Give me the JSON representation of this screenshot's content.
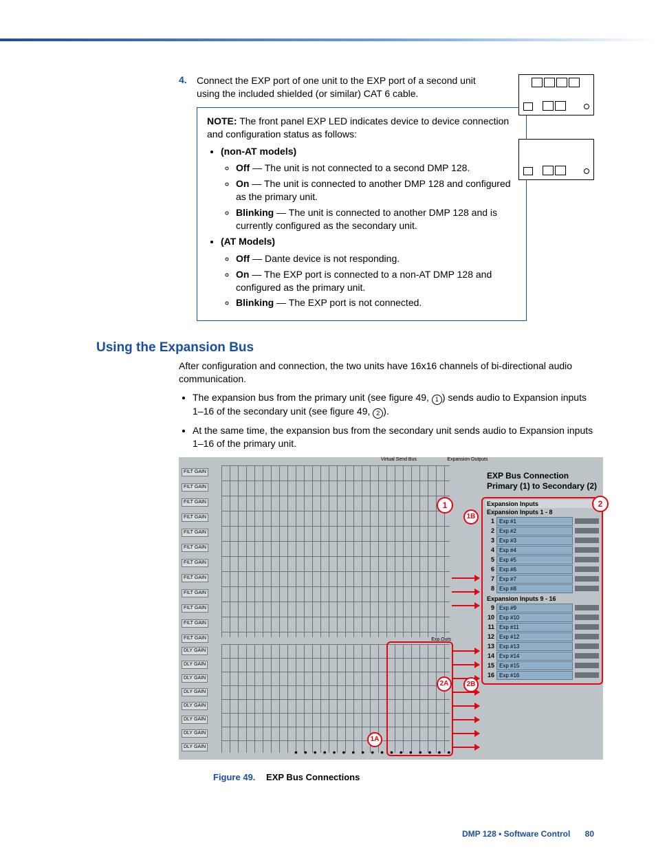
{
  "step": {
    "number": "4.",
    "text": "Connect the EXP port of one unit to the EXP port of a second unit using the included shielded (or similar) CAT 6 cable."
  },
  "note": {
    "label": "NOTE:",
    "intro": "The front panel EXP LED indicates device to device connection and configuration status as follows:",
    "groups": [
      {
        "title": "(non-AT models)",
        "items": [
          {
            "state": "Off",
            "desc": "— The unit is not connected to a second DMP 128."
          },
          {
            "state": "On",
            "desc": "— The unit is connected to another DMP 128 and configured as the primary unit."
          },
          {
            "state": "Blinking",
            "desc": "— The unit is connected to another DMP 128 and is currently configured as the secondary unit."
          }
        ]
      },
      {
        "title": "(AT Models)",
        "items": [
          {
            "state": "Off",
            "desc": "— Dante device is not responding."
          },
          {
            "state": "On",
            "desc": "— The EXP port is connected to a non-AT DMP 128 and configured as the primary unit."
          },
          {
            "state": "Blinking",
            "desc": "— The EXP port is not connected."
          }
        ]
      }
    ]
  },
  "section_title": "Using the Expansion Bus",
  "section_intro": "After configuration and connection, the two units have 16x16 channels of bi-directional audio communication.",
  "bullets": [
    {
      "pre": "The expansion bus from the primary unit (see figure 49, ",
      "ref": "1",
      "mid": ") sends audio to Expansion inputs 1–16 of the secondary unit (see figure 49, ",
      "ref2": "2",
      "post": ")."
    },
    {
      "text": "At the same time, the expansion bus from the secondary unit sends audio to Expansion inputs 1–16 of the primary unit."
    }
  ],
  "fig49": {
    "col_head_left": "Virtual Send Bus",
    "col_head_right": "Expansion Outputs",
    "exp_outs_label": "Exp.Outs",
    "right_title_l1": "EXP Bus Connection",
    "right_title_l2": "Primary (1) to Secondary (2)",
    "exp_inputs_head": "Expansion Inputs",
    "exp_inputs_sub1": "Expansion Inputs 1 - 8",
    "exp_inputs_sub2": "Expansion Inputs 9 - 16",
    "rows1": [
      {
        "n": "1",
        "lab": "Exp #1"
      },
      {
        "n": "2",
        "lab": "Exp #2"
      },
      {
        "n": "3",
        "lab": "Exp #3"
      },
      {
        "n": "4",
        "lab": "Exp #4"
      },
      {
        "n": "5",
        "lab": "Exp #5"
      },
      {
        "n": "6",
        "lab": "Exp #6"
      },
      {
        "n": "7",
        "lab": "Exp #7"
      },
      {
        "n": "8",
        "lab": "Exp #8"
      }
    ],
    "rows2": [
      {
        "n": "9",
        "lab": "Exp #9"
      },
      {
        "n": "10",
        "lab": "Exp #10"
      },
      {
        "n": "11",
        "lab": "Exp #11"
      },
      {
        "n": "12",
        "lab": "Exp #12"
      },
      {
        "n": "13",
        "lab": "Exp #13"
      },
      {
        "n": "14",
        "lab": "Exp #14"
      },
      {
        "n": "15",
        "lab": "Exp #15"
      },
      {
        "n": "16",
        "lab": "Exp #16"
      }
    ],
    "callouts": {
      "c1": "1",
      "c2": "2",
      "c1a": "1A",
      "c1b": "1B",
      "c2a": "2A",
      "c2b": "2B"
    }
  },
  "caption": {
    "prefix": "Figure 49.",
    "text": "EXP Bus Connections"
  },
  "footer": {
    "text": "DMP 128 • Software Control",
    "page": "80"
  }
}
